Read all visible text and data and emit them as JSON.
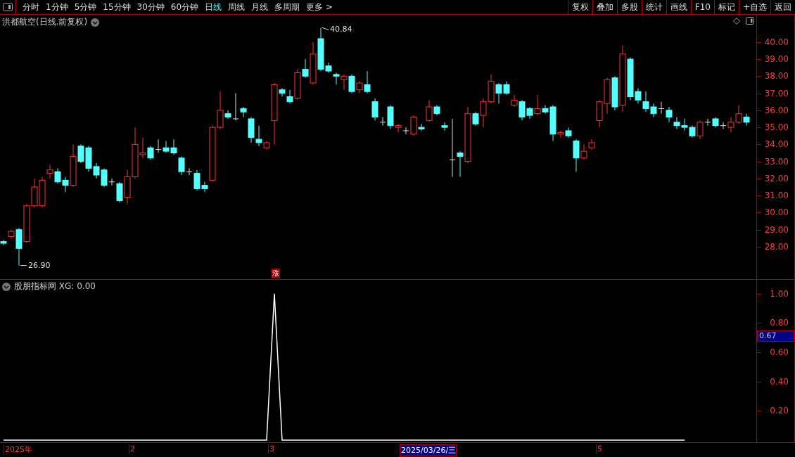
{
  "toolbar": {
    "periods": [
      {
        "label": "分时",
        "selected": false
      },
      {
        "label": "1分钟",
        "selected": false
      },
      {
        "label": "5分钟",
        "selected": false
      },
      {
        "label": "15分钟",
        "selected": false
      },
      {
        "label": "30分钟",
        "selected": false
      },
      {
        "label": "60分钟",
        "selected": false
      },
      {
        "label": "日线",
        "selected": true
      },
      {
        "label": "周线",
        "selected": false
      },
      {
        "label": "月线",
        "selected": false
      },
      {
        "label": "多周期",
        "selected": false
      },
      {
        "label": "更多 >",
        "selected": false
      }
    ],
    "buttons": [
      "复权",
      "叠加",
      "多股",
      "统计",
      "画线",
      "F10",
      "标记",
      "+自选",
      "返回"
    ]
  },
  "price_panel": {
    "title": "洪都航空(日线.前复权)",
    "high_label": "40.84",
    "low_label": "26.90",
    "limit_up_mark": "涨",
    "chart_data": {
      "type": "candlestick",
      "ylim": [
        26.1,
        41.6
      ],
      "yticks": [
        {
          "value": 40,
          "label": "40.00"
        },
        {
          "value": 39,
          "label": "39.00"
        },
        {
          "value": 38,
          "label": "38.00"
        },
        {
          "value": 37,
          "label": "37.00"
        },
        {
          "value": 36,
          "label": "36.00"
        },
        {
          "value": 35,
          "label": "35.00"
        },
        {
          "value": 34,
          "label": "34.00"
        },
        {
          "value": 33,
          "label": "33.00"
        },
        {
          "value": 32,
          "label": "32.00"
        },
        {
          "value": 31,
          "label": "31.00"
        },
        {
          "value": 30,
          "label": "30.00"
        },
        {
          "value": 29,
          "label": "29.00"
        },
        {
          "value": 28,
          "label": "28.00"
        }
      ],
      "ohlc": [
        [
          28.3,
          28.4,
          28.1,
          28.2
        ],
        [
          28.6,
          29.0,
          28.5,
          28.9
        ],
        [
          29.0,
          29.1,
          26.9,
          27.9
        ],
        [
          28.3,
          30.5,
          28.2,
          30.4
        ],
        [
          30.4,
          32.0,
          30.3,
          31.5
        ],
        [
          30.4,
          32.1,
          30.3,
          31.9
        ],
        [
          32.3,
          32.8,
          32.0,
          32.5
        ],
        [
          32.4,
          32.6,
          31.7,
          31.8
        ],
        [
          31.9,
          32.1,
          31.2,
          31.6
        ],
        [
          31.6,
          34.0,
          31.5,
          33.3
        ],
        [
          33.9,
          34.0,
          32.9,
          33.0
        ],
        [
          33.8,
          33.9,
          32.4,
          32.6
        ],
        [
          32.7,
          32.9,
          32.0,
          32.2
        ],
        [
          32.5,
          32.6,
          31.5,
          31.6
        ],
        [
          31.8,
          32.0,
          31.6,
          31.8
        ],
        [
          31.7,
          31.8,
          30.6,
          30.7
        ],
        [
          30.9,
          32.5,
          30.5,
          32.1
        ],
        [
          32.1,
          35.0,
          32.0,
          34.0
        ],
        [
          33.4,
          34.4,
          33.2,
          33.5
        ],
        [
          33.8,
          33.9,
          33.1,
          33.2
        ],
        [
          33.7,
          34.3,
          33.5,
          33.7
        ],
        [
          33.8,
          34.2,
          33.5,
          33.6
        ],
        [
          33.8,
          34.3,
          33.4,
          33.5
        ],
        [
          33.2,
          33.3,
          32.2,
          32.4
        ],
        [
          32.4,
          32.6,
          32.2,
          32.4
        ],
        [
          32.3,
          32.5,
          31.3,
          31.4
        ],
        [
          31.6,
          31.8,
          31.2,
          31.4
        ],
        [
          31.9,
          35.1,
          31.8,
          35.0
        ],
        [
          35.0,
          37.1,
          34.9,
          36.0
        ],
        [
          35.8,
          36.0,
          35.5,
          35.6
        ],
        [
          35.5,
          37.0,
          35.4,
          35.5
        ],
        [
          36.1,
          36.2,
          35.6,
          35.9
        ],
        [
          35.5,
          35.6,
          34.1,
          34.4
        ],
        [
          34.3,
          35.1,
          33.9,
          34.1
        ],
        [
          33.8,
          34.2,
          33.7,
          34.1
        ],
        [
          35.4,
          37.6,
          34.0,
          37.5
        ],
        [
          37.2,
          37.3,
          36.8,
          37.0
        ],
        [
          36.8,
          37.2,
          36.4,
          36.5
        ],
        [
          36.7,
          38.4,
          36.6,
          38.2
        ],
        [
          38.4,
          39.0,
          37.9,
          38.0
        ],
        [
          37.6,
          40.0,
          37.5,
          39.3
        ],
        [
          40.2,
          40.84,
          38.3,
          38.4
        ],
        [
          38.6,
          38.8,
          38.2,
          38.3
        ],
        [
          38.1,
          38.2,
          37.5,
          38.0
        ],
        [
          37.8,
          38.1,
          37.2,
          38.0
        ],
        [
          38.0,
          38.1,
          37.0,
          37.1
        ],
        [
          37.2,
          37.7,
          37.0,
          37.6
        ],
        [
          37.5,
          38.3,
          37.0,
          37.1
        ],
        [
          36.5,
          36.7,
          35.4,
          35.6
        ],
        [
          35.3,
          35.6,
          35.1,
          35.3
        ],
        [
          36.2,
          36.3,
          34.9,
          35.1
        ],
        [
          35.0,
          35.2,
          34.7,
          35.1
        ],
        [
          34.8,
          35.0,
          34.6,
          34.8
        ],
        [
          34.6,
          35.7,
          34.5,
          35.6
        ],
        [
          35.0,
          35.2,
          34.8,
          34.9
        ],
        [
          35.4,
          36.6,
          35.3,
          36.2
        ],
        [
          36.2,
          36.3,
          35.7,
          35.8
        ],
        [
          35.1,
          35.3,
          34.8,
          35.0
        ],
        [
          33.1,
          35.5,
          32.1,
          33.1
        ],
        [
          33.5,
          33.6,
          32.1,
          33.3
        ],
        [
          33.0,
          36.2,
          32.9,
          35.8
        ],
        [
          35.8,
          35.9,
          35.1,
          35.2
        ],
        [
          35.7,
          36.7,
          35.0,
          36.5
        ],
        [
          36.5,
          38.1,
          36.4,
          37.7
        ],
        [
          37.5,
          37.6,
          36.4,
          37.0
        ],
        [
          37.5,
          37.7,
          36.9,
          37.0
        ],
        [
          36.3,
          36.9,
          36.2,
          36.6
        ],
        [
          36.5,
          36.6,
          35.4,
          35.6
        ],
        [
          36.1,
          36.2,
          35.5,
          35.7
        ],
        [
          35.8,
          36.9,
          35.7,
          36.1
        ],
        [
          36.1,
          36.3,
          35.8,
          35.9
        ],
        [
          36.2,
          36.3,
          34.2,
          34.6
        ],
        [
          34.6,
          34.8,
          34.4,
          34.7
        ],
        [
          34.8,
          35.0,
          34.4,
          34.5
        ],
        [
          34.2,
          34.3,
          32.4,
          33.2
        ],
        [
          33.2,
          34.0,
          33.1,
          33.6
        ],
        [
          33.8,
          34.3,
          33.7,
          34.1
        ],
        [
          35.4,
          36.6,
          35.0,
          36.5
        ],
        [
          36.4,
          37.9,
          35.8,
          37.8
        ],
        [
          37.9,
          38.0,
          36.0,
          36.2
        ],
        [
          36.3,
          39.8,
          35.9,
          39.3
        ],
        [
          39.0,
          39.1,
          36.6,
          36.8
        ],
        [
          37.1,
          37.3,
          36.4,
          36.6
        ],
        [
          36.5,
          37.1,
          35.9,
          36.1
        ],
        [
          36.2,
          36.4,
          35.6,
          35.8
        ],
        [
          36.1,
          36.5,
          35.8,
          36.1
        ],
        [
          36.0,
          36.2,
          35.3,
          35.6
        ],
        [
          35.3,
          35.6,
          34.9,
          35.1
        ],
        [
          35.1,
          35.5,
          34.8,
          35.0
        ],
        [
          35.0,
          35.1,
          34.4,
          34.5
        ],
        [
          34.5,
          35.4,
          34.3,
          35.3
        ],
        [
          35.3,
          35.5,
          35.1,
          35.3
        ],
        [
          35.5,
          35.6,
          35.0,
          35.1
        ],
        [
          35.1,
          35.3,
          34.9,
          35.1
        ],
        [
          35.0,
          35.6,
          34.7,
          35.3
        ],
        [
          35.3,
          36.3,
          35.2,
          35.8
        ],
        [
          35.6,
          35.8,
          35.1,
          35.3
        ]
      ]
    }
  },
  "indicator_panel": {
    "title": "股朋指标网 XG: 0.00",
    "cursor_value": "0.67",
    "chart_data": {
      "type": "line",
      "ylim": [
        -0.01,
        1.1
      ],
      "categories": [
        null,
        null,
        null,
        null,
        null,
        null,
        null,
        null,
        null,
        null,
        null,
        null,
        null,
        null,
        null,
        null,
        null,
        null,
        null,
        null,
        null,
        null,
        null,
        null,
        null,
        null,
        null,
        null,
        null,
        null,
        null,
        null,
        null,
        null,
        null,
        null,
        null,
        null,
        null,
        null,
        null,
        null,
        null,
        null,
        null,
        null,
        null,
        null,
        null,
        null,
        null,
        null,
        null,
        null,
        null,
        null,
        null,
        null,
        null,
        null,
        null,
        null,
        null,
        null,
        null,
        null,
        null,
        null,
        null,
        null,
        null,
        null,
        null,
        null,
        null,
        null,
        null,
        null,
        null,
        null,
        null,
        null,
        null,
        null,
        null,
        null,
        null,
        null,
        null
      ],
      "yticks": [
        {
          "value": 1,
          "label": "1.00"
        },
        {
          "value": 0.8,
          "label": "0.80"
        },
        {
          "value": 0.6,
          "label": "0.60"
        },
        {
          "value": 0.4,
          "label": "0.40"
        },
        {
          "value": 0.2,
          "label": "0.20"
        }
      ],
      "series": [
        {
          "color": "#ffffff",
          "values": [
            0,
            0,
            0,
            0,
            0,
            0,
            0,
            0,
            0,
            0,
            0,
            0,
            0,
            0,
            0,
            0,
            0,
            0,
            0,
            0,
            0,
            0,
            0,
            0,
            0,
            0,
            0,
            0,
            0,
            0,
            0,
            0,
            0,
            0,
            0,
            1,
            0,
            0,
            0,
            0,
            0,
            0,
            0,
            0,
            0,
            0,
            0,
            0,
            0,
            0,
            0,
            0,
            0,
            0,
            0,
            0,
            0,
            0,
            0,
            0,
            0,
            0,
            0,
            0,
            0,
            0,
            0,
            0,
            0,
            0,
            0,
            0,
            0,
            0,
            0,
            0,
            0,
            0,
            0,
            0,
            0,
            0,
            0,
            0,
            0,
            0,
            0,
            0,
            0
          ]
        }
      ]
    }
  },
  "time_axis": [
    {
      "text": "2025年",
      "selected": false
    },
    {
      "text": "2",
      "selected": false
    },
    {
      "text": "3",
      "selected": false
    },
    {
      "text": "2025/03/26/三",
      "selected": true
    },
    {
      "text": "5",
      "selected": false
    }
  ]
}
